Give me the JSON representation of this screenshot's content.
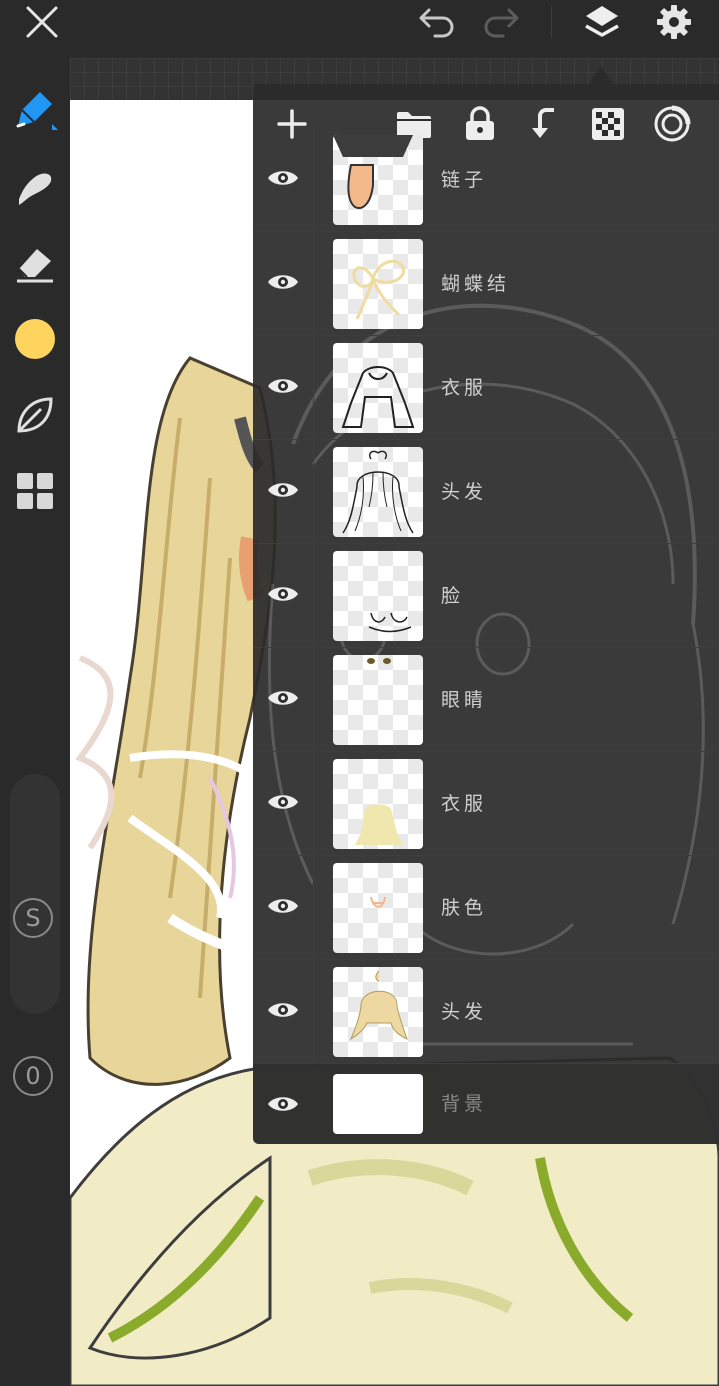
{
  "top_bar": {
    "icons": [
      "close-icon",
      "undo-icon",
      "redo-icon",
      "layers-icon",
      "settings-icon"
    ]
  },
  "toolbar": {
    "tools": [
      "pen-icon",
      "smudge-icon",
      "eraser-icon",
      "color-swatch",
      "blend-leaf-icon",
      "gallery-grid-icon"
    ],
    "brush_size_label": "S",
    "opacity_label": "0",
    "colors": {
      "accent": "#2196f3",
      "current_color": "#ffd45e"
    }
  },
  "layers_panel": {
    "actions": [
      "add-layer-icon",
      "folder-icon",
      "lock-icon",
      "merge-down-icon",
      "transparency-checker-icon",
      "layer-mode-icon"
    ],
    "layers": [
      {
        "name": "链子",
        "visible": true
      },
      {
        "name": "蝴蝶结",
        "visible": true
      },
      {
        "name": "衣服",
        "visible": true
      },
      {
        "name": "头发",
        "visible": true
      },
      {
        "name": "脸",
        "visible": true
      },
      {
        "name": "眼睛",
        "visible": true
      },
      {
        "name": "衣服",
        "visible": true
      },
      {
        "name": "肤色",
        "visible": true
      },
      {
        "name": "头发",
        "visible": true
      },
      {
        "name": "背景",
        "visible": true
      }
    ]
  }
}
